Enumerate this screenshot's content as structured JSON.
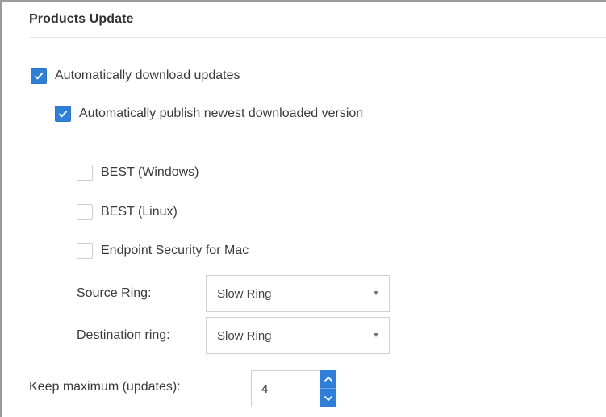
{
  "section": {
    "title": "Products Update"
  },
  "options": {
    "auto_download": {
      "label": "Automatically download updates",
      "checked": true
    },
    "auto_publish": {
      "label": "Automatically publish newest downloaded version",
      "checked": true
    },
    "products": [
      {
        "label": "BEST (Windows)",
        "checked": false
      },
      {
        "label": "BEST (Linux)",
        "checked": false
      },
      {
        "label": "Endpoint Security for Mac",
        "checked": false
      }
    ]
  },
  "rings": {
    "source": {
      "label": "Source Ring:",
      "value": "Slow Ring"
    },
    "destination": {
      "label": "Destination ring:",
      "value": "Slow Ring"
    }
  },
  "keep_max": {
    "label": "Keep maximum (updates):",
    "value": "4"
  },
  "colors": {
    "accent": "#2f7fd8",
    "border": "#d0d0d0",
    "text": "#3a3a3a"
  },
  "icons": {
    "checked": "checkmark-icon",
    "dropdown": "chevron-down-icon",
    "stepper_up": "chevron-up-icon",
    "stepper_down": "chevron-down-icon"
  }
}
